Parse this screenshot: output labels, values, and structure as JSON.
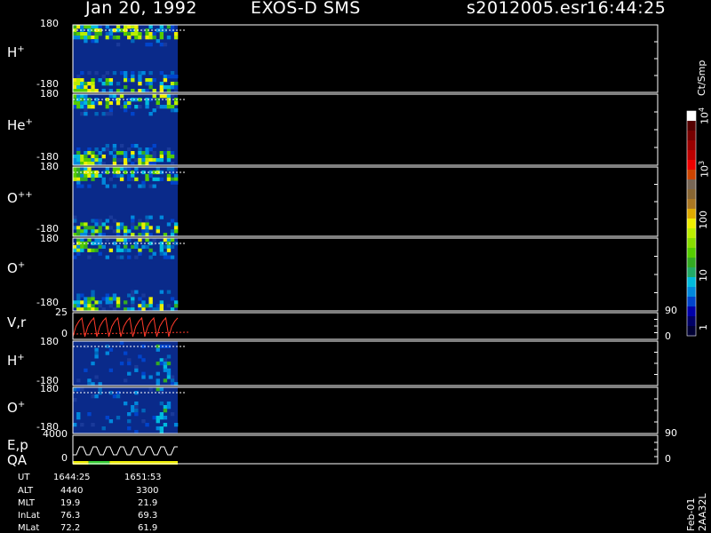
{
  "header": {
    "date": "Jan 20, 1992",
    "instrument": "EXOS-D SMS",
    "file": "s2012005.esr",
    "time": "16:44:25"
  },
  "colors": {
    "background": "#000000",
    "border": "#ffffff",
    "cell_fill": "#0a2a8a",
    "vr_line": "#ff3a2a"
  },
  "panels": [
    {
      "label": "H",
      "charge": "+",
      "ymax": "180",
      "ymin": "-180"
    },
    {
      "label": "He",
      "charge": "+",
      "ymax": "180",
      "ymin": "-180"
    },
    {
      "label": "O",
      "charge": "++",
      "ymax": "180",
      "ymin": "-180"
    },
    {
      "label": "O",
      "charge": "+",
      "ymax": "180",
      "ymin": "-180"
    },
    {
      "label": "V,r",
      "charge": "",
      "ymax": "25",
      "ymin": "0",
      "rmax": "90",
      "rmin": "0"
    },
    {
      "label": "H",
      "charge": "+",
      "ymax": "180",
      "ymin": "-180"
    },
    {
      "label": "O",
      "charge": "+",
      "ymax": "180",
      "ymin": "-180"
    },
    {
      "label": "E,p",
      "charge": "",
      "ymax": "4000",
      "ymin": "0",
      "rmax": "90",
      "rmin": "0"
    }
  ],
  "qa_label": "QA",
  "colorbar": {
    "unit": "Ct/Smp",
    "ticks": [
      "1",
      "10",
      "100",
      "10",
      "10"
    ],
    "exponents": [
      "",
      "",
      "",
      "3",
      "4"
    ],
    "ramp": [
      "#000033",
      "#000066",
      "#0000aa",
      "#0044cc",
      "#0088dd",
      "#00bbdd",
      "#22aa66",
      "#33aa22",
      "#55cc00",
      "#88dd00",
      "#bbee00",
      "#eeee00",
      "#ddaa00",
      "#aa7722",
      "#886633",
      "#776655",
      "#cc4400",
      "#ee0000",
      "#bb0000",
      "#990000",
      "#770000",
      "#550000",
      "#ffffff"
    ]
  },
  "info": {
    "rows": [
      {
        "label": "UT",
        "v1": "1644:25",
        "v2": "1651:53"
      },
      {
        "label": "ALT",
        "v1": "4440",
        "v2": "3300"
      },
      {
        "label": "MLT",
        "v1": "19.9",
        "v2": "21.9"
      },
      {
        "label": "InLat",
        "v1": "76.3",
        "v2": "69.3"
      },
      {
        "label": "MLat",
        "v1": "72.2",
        "v2": "61.9"
      }
    ]
  },
  "footer": "Feb-01 2AA32L",
  "chart_data": {
    "type": "heatmap",
    "title": "Jan 20, 1992  EXOS-D SMS",
    "xlabel": "",
    "ylabel": "",
    "x_range_ut": [
      "1644:25",
      "1651:53"
    ],
    "data_coverage_fraction": 0.14,
    "vr_values": [
      0,
      12,
      18,
      22,
      0,
      12,
      18,
      22,
      0,
      12,
      18,
      22,
      0,
      12,
      18,
      22,
      0,
      12,
      18,
      22,
      0,
      12,
      18,
      22,
      0,
      12,
      18,
      22,
      0,
      12,
      18,
      22,
      0,
      12,
      18,
      22
    ],
    "ep_values": [
      0,
      0,
      2000,
      2000,
      0,
      0,
      2000,
      2000,
      0,
      0,
      2000,
      2000,
      0,
      0,
      2000,
      2000,
      0,
      0,
      2000,
      2000,
      0,
      0,
      2000,
      2000,
      0,
      0,
      2000,
      2000,
      0,
      0,
      2000,
      2000
    ],
    "qa_segments": [
      {
        "from": 0.0,
        "to": 0.15,
        "color": "#eeee00"
      },
      {
        "from": 0.15,
        "to": 0.35,
        "color": "#33cc33"
      },
      {
        "from": 0.35,
        "to": 1.0,
        "color": "#eeee00"
      }
    ]
  }
}
